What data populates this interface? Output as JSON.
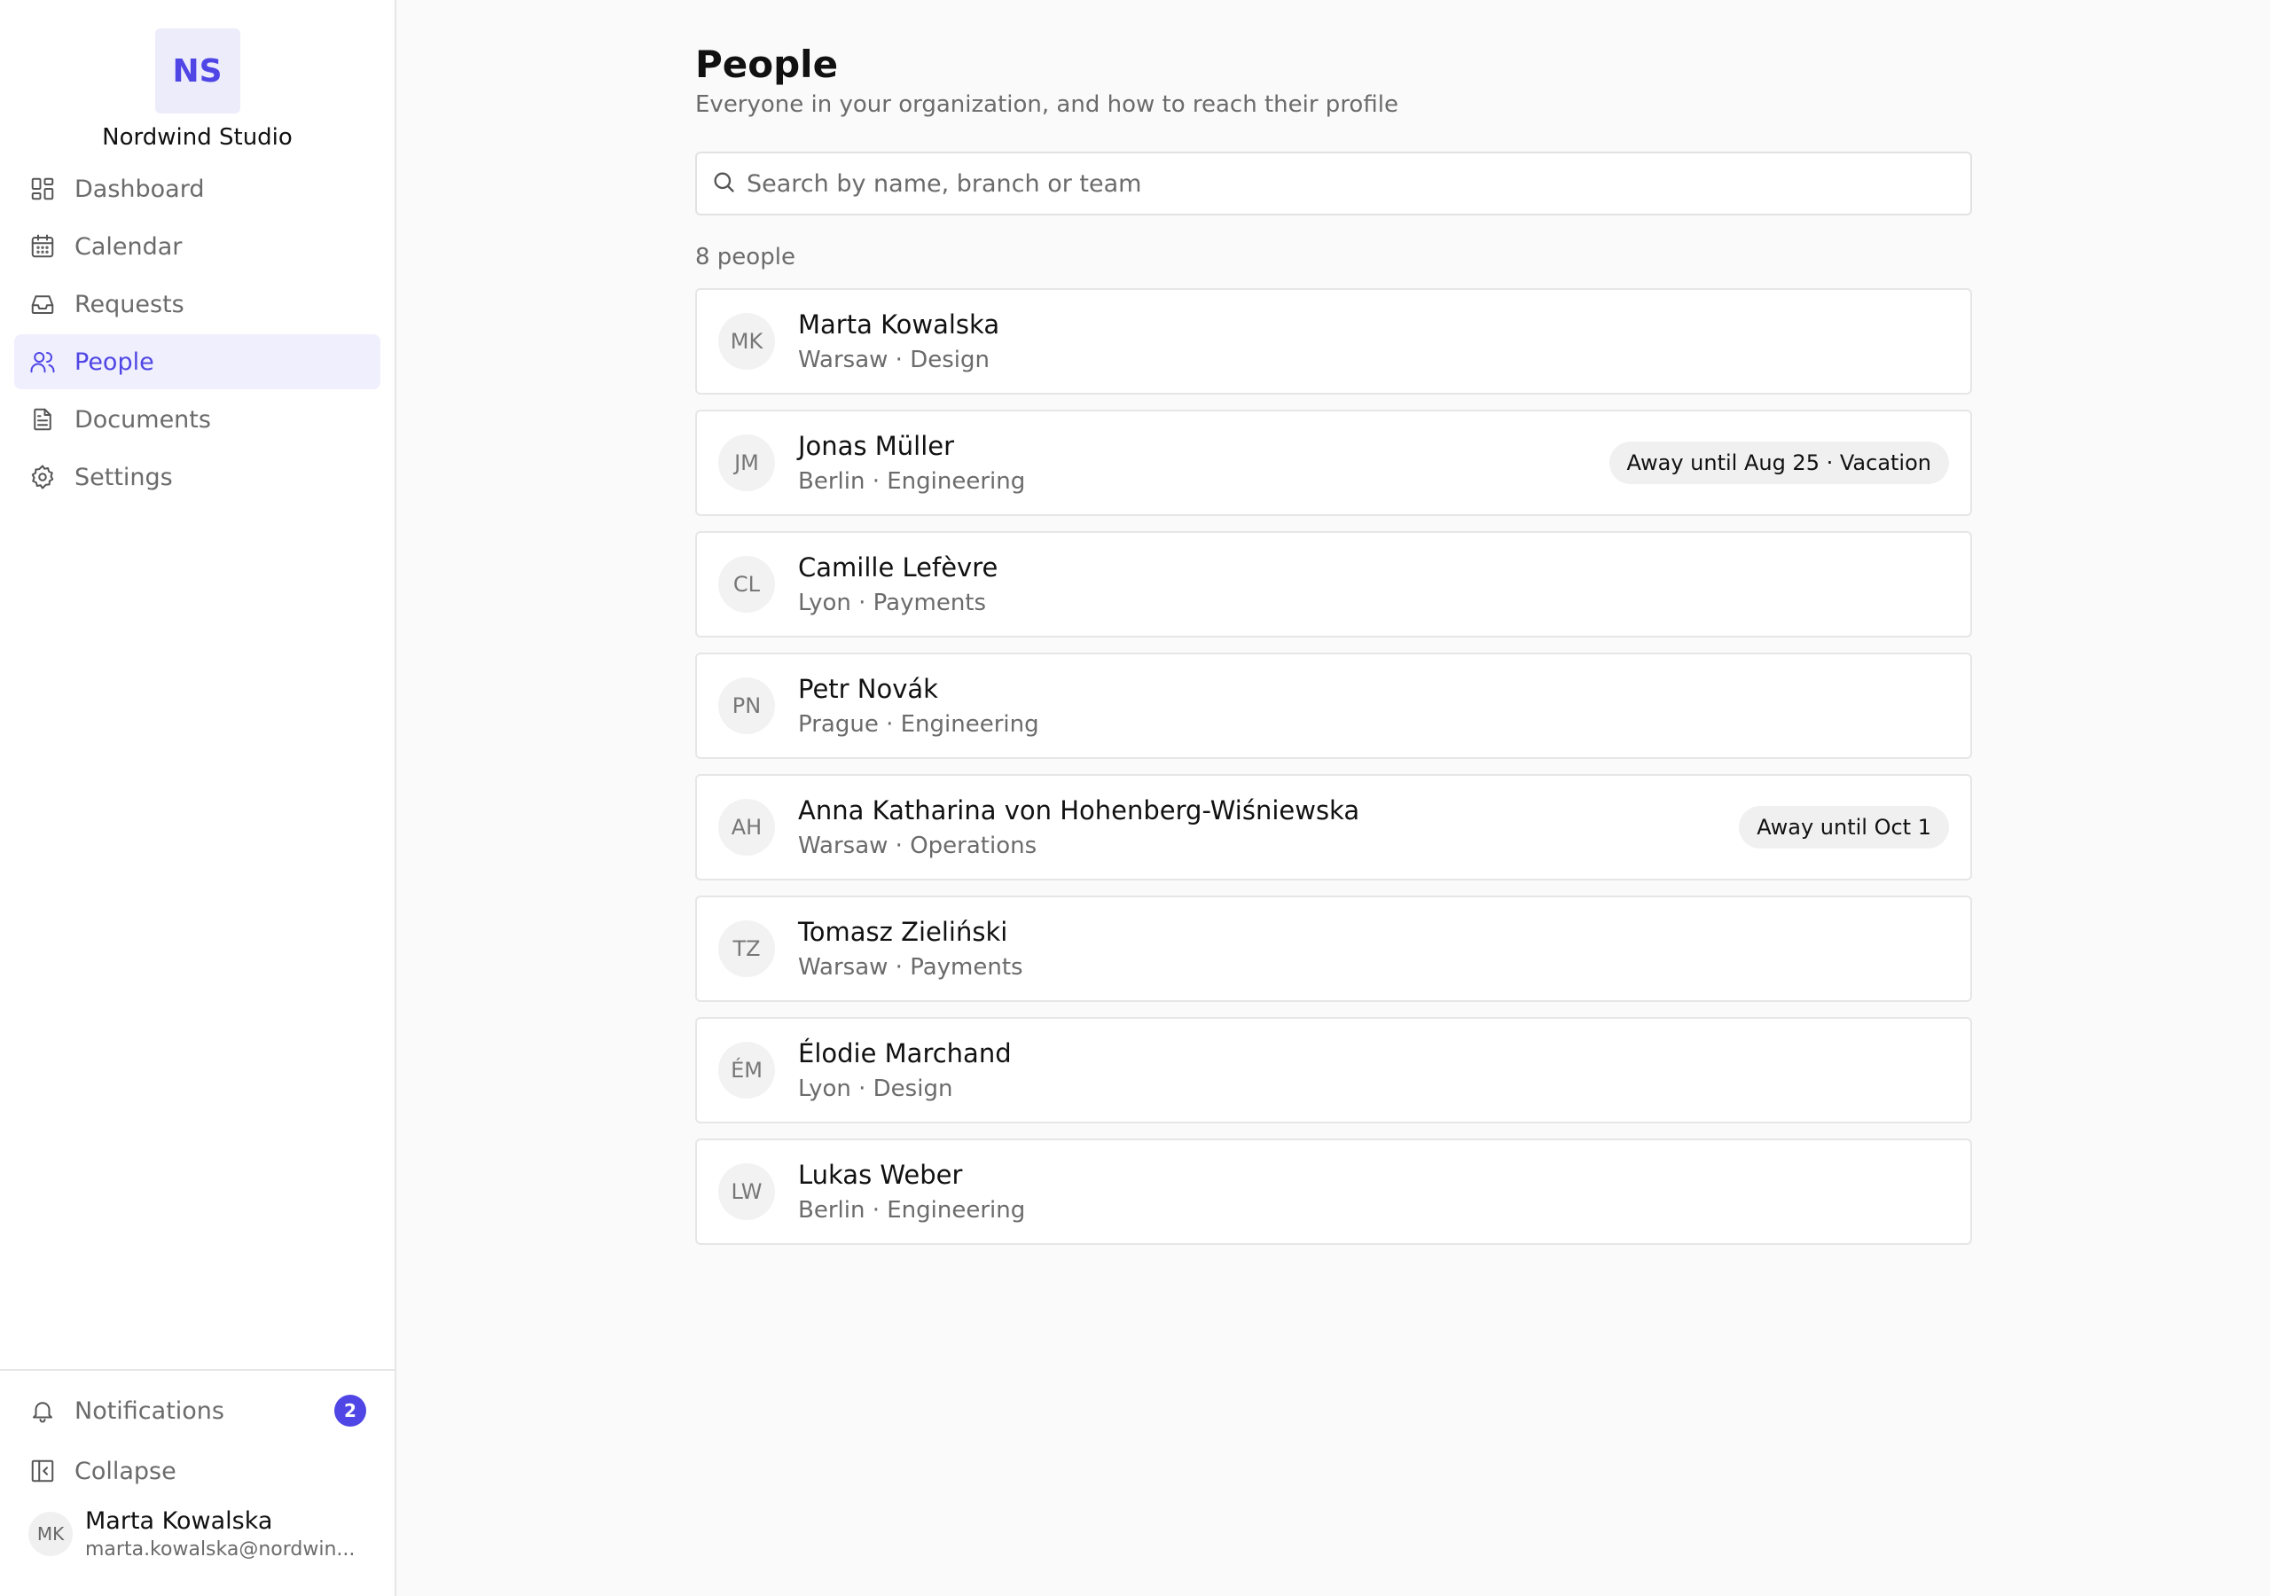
{
  "brand": {
    "initials": "NS",
    "name": "Nordwind Studio"
  },
  "nav": [
    {
      "label": "Dashboard",
      "icon": "dashboard-icon",
      "active": false
    },
    {
      "label": "Calendar",
      "icon": "calendar-icon",
      "active": false
    },
    {
      "label": "Requests",
      "icon": "inbox-icon",
      "active": false
    },
    {
      "label": "People",
      "icon": "people-icon",
      "active": true
    },
    {
      "label": "Documents",
      "icon": "document-icon",
      "active": false
    },
    {
      "label": "Settings",
      "icon": "gear-icon",
      "active": false
    }
  ],
  "bottom": {
    "notifications_label": "Notifications",
    "notifications_count": "2",
    "collapse_label": "Collapse"
  },
  "user": {
    "initials": "MK",
    "name": "Marta Kowalska",
    "email": "marta.kowalska@nordwin..."
  },
  "page": {
    "title": "People",
    "subtitle": "Everyone in your organization, and how to reach their profile",
    "search_placeholder": "Search by name, branch or team",
    "count": "8 people"
  },
  "people": [
    {
      "initials": "MK",
      "name": "Marta Kowalska",
      "meta": "Warsaw · Design",
      "status": ""
    },
    {
      "initials": "JM",
      "name": "Jonas Müller",
      "meta": "Berlin · Engineering",
      "status": "Away until Aug 25 · Vacation"
    },
    {
      "initials": "CL",
      "name": "Camille Lefèvre",
      "meta": "Lyon · Payments",
      "status": ""
    },
    {
      "initials": "PN",
      "name": "Petr Novák",
      "meta": "Prague · Engineering",
      "status": ""
    },
    {
      "initials": "AH",
      "name": "Anna Katharina von Hohenberg-Wiśniewska",
      "meta": "Warsaw · Operations",
      "status": "Away until Oct 1"
    },
    {
      "initials": "TZ",
      "name": "Tomasz Zieliński",
      "meta": "Warsaw · Payments",
      "status": ""
    },
    {
      "initials": "ÉM",
      "name": "Élodie Marchand",
      "meta": "Lyon · Design",
      "status": ""
    },
    {
      "initials": "LW",
      "name": "Lukas Weber",
      "meta": "Berlin · Engineering",
      "status": ""
    }
  ],
  "colors": {
    "accent": "#4f46e5",
    "accent_bg": "#f0effd"
  }
}
